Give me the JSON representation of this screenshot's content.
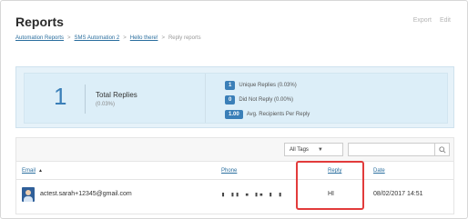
{
  "header": {
    "title": "Reports",
    "actions": [
      "Export",
      "Edit"
    ]
  },
  "breadcrumb": {
    "items": [
      "Automation Reports",
      "SMS Automation 2",
      "Hello there!"
    ],
    "separator": ">",
    "current": "Reply reports"
  },
  "stats": {
    "total_value": "1",
    "total_label": "Total Replies",
    "total_pct": "(0.03%)",
    "metrics": [
      {
        "value": "1",
        "label": "Unique Replies (0.03%)"
      },
      {
        "value": "0",
        "label": "Did Not Reply (0.00%)"
      },
      {
        "value": "1.00",
        "label": "Avg. Recipients Per Reply"
      }
    ]
  },
  "table": {
    "filter_label": "All Tags",
    "search_placeholder": "",
    "columns": {
      "email": "Email",
      "phone": "Phone",
      "reply": "Reply",
      "date": "Date"
    },
    "rows": [
      {
        "email": "actest.sarah+12345@gmail.com",
        "phone": "▮ ▮▮ ▪ ▮▪ ▮ ▮",
        "reply": "HI",
        "date": "08/02/2017 14:51"
      }
    ]
  },
  "colors": {
    "accent": "#3a7fb8",
    "link": "#2a6e9e",
    "highlight": "#e23b3b",
    "stats_bg": "#e6f2f9"
  }
}
